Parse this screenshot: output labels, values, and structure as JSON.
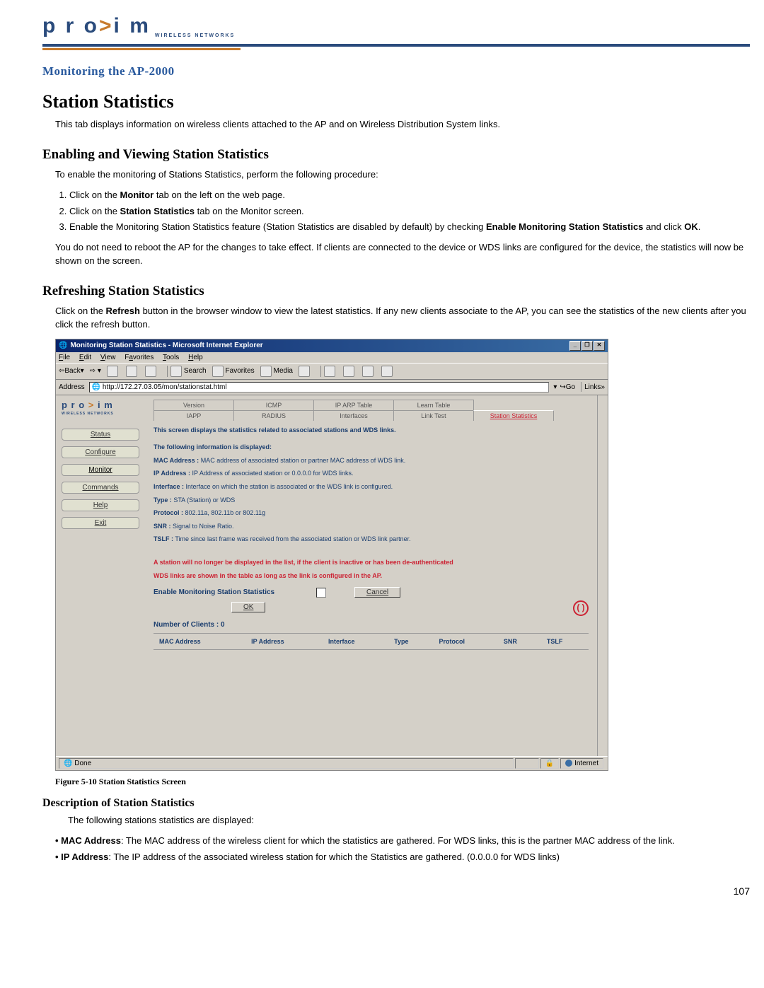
{
  "header": {
    "logo_text": "proxim",
    "logo_sub": "WIRELESS NETWORKS"
  },
  "breadcrumb": "Monitoring the AP-2000",
  "h1": "Station Statistics",
  "intro": "This tab displays information on wireless clients attached to the AP and on Wireless Distribution System links.",
  "h2a": "Enabling and Viewing Station Statistics",
  "enable_intro": "To enable the monitoring of Stations Statistics, perform the following procedure:",
  "steps": {
    "s1a": "Click on the ",
    "s1b": "Monitor",
    "s1c": " tab on the left on the web page.",
    "s2a": "Click on the ",
    "s2b": "Station Statistics",
    "s2c": " tab on the Monitor screen.",
    "s3a": "Enable the Monitoring Station Statistics feature (Station Statistics are disabled by default) by checking ",
    "s3b": "Enable Monitoring Station Statistics",
    "s3c": " and click ",
    "s3d": "OK",
    "s3e": "."
  },
  "enable_note": "You do not need to reboot the AP for the changes to take effect. If clients are connected to the device or WDS links are configured for the device, the statistics will now be shown on the screen.",
  "h2b": "Refreshing Station Statistics",
  "refresh_a": "Click on the ",
  "refresh_b": "Refresh",
  "refresh_c": " button in the browser window to view the latest statistics. If any new clients associate to the AP, you can see the statistics of the new clients after you click the refresh button.",
  "figcap": "Figure 5-10   Station Statistics Screen",
  "h3": "Description of Station Statistics",
  "desc_intro": "The following stations statistics are displayed:",
  "bullets": {
    "b1a": "MAC Address",
    "b1b": ": The MAC address of the wireless client for which the statistics are gathered. For WDS links, this is the partner MAC address of the link.",
    "b2a": "IP Address",
    "b2b": ": The IP address of the associated wireless station for which the Statistics are gathered. (0.0.0.0 for WDS links)"
  },
  "pagenum": "107",
  "shot": {
    "title": "Monitoring Station Statistics - Microsoft Internet Explorer",
    "menu": {
      "file": "File",
      "edit": "Edit",
      "view": "View",
      "fav": "Favorites",
      "tools": "Tools",
      "help": "Help"
    },
    "toolbar": {
      "back": "Back",
      "search": "Search",
      "favorites": "Favorites",
      "media": "Media"
    },
    "addr_label": "Address",
    "addr_value": "http://172.27.03.05/mon/stationstat.html",
    "go": "Go",
    "links": "Links",
    "nav": {
      "status": "Status",
      "configure": "Configure",
      "monitor": "Monitor",
      "commands": "Commands",
      "help": "Help",
      "exit": "Exit"
    },
    "tabs_row1": {
      "version": "Version",
      "icmp": "ICMP",
      "iparp": "IP ARP Table",
      "learn": "Learn Table"
    },
    "tabs_row2": {
      "iapp": "IAPP",
      "radius": "RADIUS",
      "interfaces": "Interfaces",
      "linktest": "Link Test",
      "stationstats": "Station Statistics"
    },
    "panel": {
      "line1": "This screen displays the statistics related to associated stations and WDS links.",
      "line2": "The following information is displayed:",
      "mac_lbl": "MAC Address :",
      "mac_txt": " MAC address of associated station or partner MAC address of WDS link.",
      "ip_lbl": "IP Address :",
      "ip_txt": " IP Address of associated station or 0.0.0.0 for WDS links.",
      "if_lbl": "Interface :",
      "if_txt": " Interface on which the station is associated or the WDS link is configured.",
      "ty_lbl": "Type :",
      "ty_txt": " STA (Station) or WDS",
      "pr_lbl": "Protocol :",
      "pr_txt": " 802.11a, 802.11b or 802.11g",
      "sn_lbl": "SNR :",
      "sn_txt": " Signal to Noise Ratio.",
      "ts_lbl": "TSLF :",
      "ts_txt": " Time since last frame was received from the associated station or WDS link partner.",
      "warn1": "A station will no longer be displayed in the list, if the client is inactive or has been de-authenticated",
      "warn2": "WDS links are shown in the table as long as the link is configured in the AP.",
      "enable_label": "Enable Monitoring Station Statistics",
      "ok": "OK",
      "cancel": "Cancel",
      "clients": "Number of Clients : 0",
      "cols": {
        "mac": "MAC Address",
        "ip": "IP Address",
        "if": "Interface",
        "type": "Type",
        "proto": "Protocol",
        "snr": "SNR",
        "tslf": "TSLF"
      }
    },
    "status": {
      "done": "Done",
      "zone": "Internet"
    }
  }
}
